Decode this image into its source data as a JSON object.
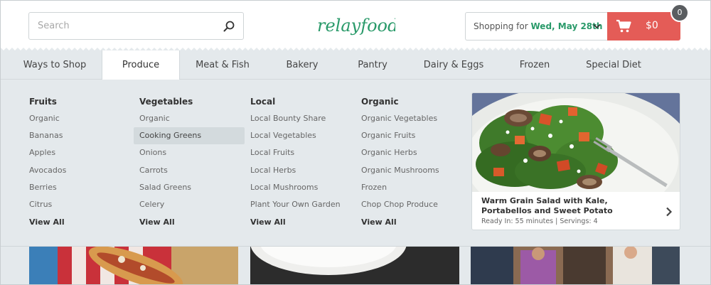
{
  "search": {
    "placeholder": "Search",
    "icon": "search-icon"
  },
  "brand": {
    "logo_text": "relayfoods",
    "color": "#2a9a6a"
  },
  "shopping": {
    "label": "Shopping for",
    "date": "Wed, May 28th"
  },
  "cart": {
    "amount": "$0",
    "count": "0",
    "color": "#e45c57"
  },
  "nav": {
    "tabs": [
      {
        "label": "Ways to Shop"
      },
      {
        "label": "Produce",
        "active": true
      },
      {
        "label": "Meat & Fish"
      },
      {
        "label": "Bakery"
      },
      {
        "label": "Pantry"
      },
      {
        "label": "Dairy & Eggs"
      },
      {
        "label": "Frozen"
      },
      {
        "label": "Special Diet"
      }
    ]
  },
  "menu": {
    "columns": [
      {
        "heading": "Fruits",
        "items": [
          "Organic",
          "Bananas",
          "Apples",
          "Avocados",
          "Berries",
          "Citrus"
        ],
        "view_all": "View All"
      },
      {
        "heading": "Vegetables",
        "items": [
          "Organic",
          "Cooking Greens",
          "Onions",
          "Carrots",
          "Salad Greens",
          "Celery"
        ],
        "view_all": "View All",
        "highlighted": "Cooking Greens"
      },
      {
        "heading": "Local",
        "items": [
          "Local Bounty Share",
          "Local Vegetables",
          "Local Fruits",
          "Local Herbs",
          "Local Mushrooms",
          "Plant Your Own Garden"
        ],
        "view_all": "View All"
      },
      {
        "heading": "Organic",
        "items": [
          "Organic Vegetables",
          "Organic Fruits",
          "Organic Herbs",
          "Organic Mushrooms",
          "Frozen",
          "Chop Chop Produce"
        ],
        "view_all": "View All"
      }
    ]
  },
  "recipe": {
    "title": "Warm Grain Salad with Kale, Portabellos and Sweet Potato",
    "meta": "Ready In: 55 minutes | Servings: 4"
  }
}
